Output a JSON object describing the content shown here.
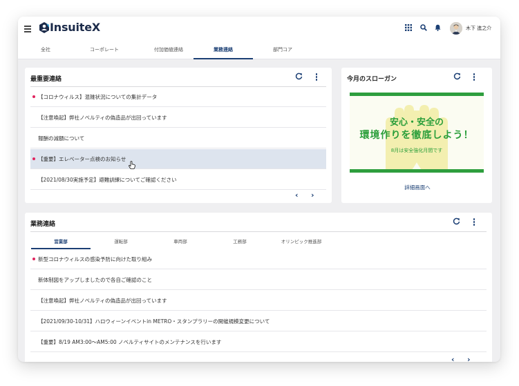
{
  "header": {
    "brand": "InsuiteX",
    "user_name": "木下 進之介",
    "icons": [
      "hamburger-icon",
      "apps-grid-icon",
      "search-icon",
      "bell-icon"
    ]
  },
  "nav_tabs": [
    {
      "label": "全社",
      "active": false
    },
    {
      "label": "コーポレート",
      "active": false
    },
    {
      "label": "付加価値連絡",
      "active": false
    },
    {
      "label": "業務連絡",
      "active": true
    },
    {
      "label": "部門コア",
      "active": false
    }
  ],
  "important": {
    "title": "最重要連絡",
    "items": [
      {
        "text": "【コロナウィルス】混雑状況についての集計データ",
        "unread": true
      },
      {
        "text": "【注意喚起】弊社ノベルティの偽造品が出回っています",
        "unread": false
      },
      {
        "text": "報酬の減額について",
        "unread": false
      },
      {
        "text": "【重要】エレベーター点検のお知らせ",
        "unread": true,
        "highlighted": true
      },
      {
        "text": "【2021/08/30実施予定】避難訓練についてご確認ください",
        "unread": false
      }
    ],
    "prev": "‹",
    "next": "›"
  },
  "slogan": {
    "title": "今月のスローガン",
    "line1": "安心・安全の",
    "line2": "環境作りを徹底しよう！",
    "line3": "8月は安全強化月間です",
    "detail_link": "詳細画面へ",
    "colors": {
      "accent": "#2e9e3e",
      "hands": "#f3efb0"
    }
  },
  "business": {
    "title": "業務連絡",
    "tabs": [
      {
        "label": "営業部",
        "active": true
      },
      {
        "label": "運転部",
        "active": false
      },
      {
        "label": "車両部",
        "active": false
      },
      {
        "label": "工務部",
        "active": false
      },
      {
        "label": "オリンピック推進部",
        "active": false
      }
    ],
    "items": [
      {
        "text": "新型コロナウィルスの感染予防に向けた取り組み",
        "unread": true
      },
      {
        "text": "新体制図をアップしましたので各自ご確認のこと",
        "unread": false
      },
      {
        "text": "【注意喚起】弊社ノベルティの偽造品が出回っています",
        "unread": false
      },
      {
        "text": "【2021/09/30-10/31】ハロウィーンイベントin METRO・スタンプラリーの開催規模変更について",
        "unread": false
      },
      {
        "text": "【重要】8/19 AM3:00〜AM5:00 ノベルティサイトのメンテナンスを行います",
        "unread": false
      }
    ],
    "prev": "‹",
    "next": "›"
  },
  "colors": {
    "primary": "#1b3f74",
    "unread_dot": "#e0245e",
    "highlight_row": "#dde4ee"
  }
}
